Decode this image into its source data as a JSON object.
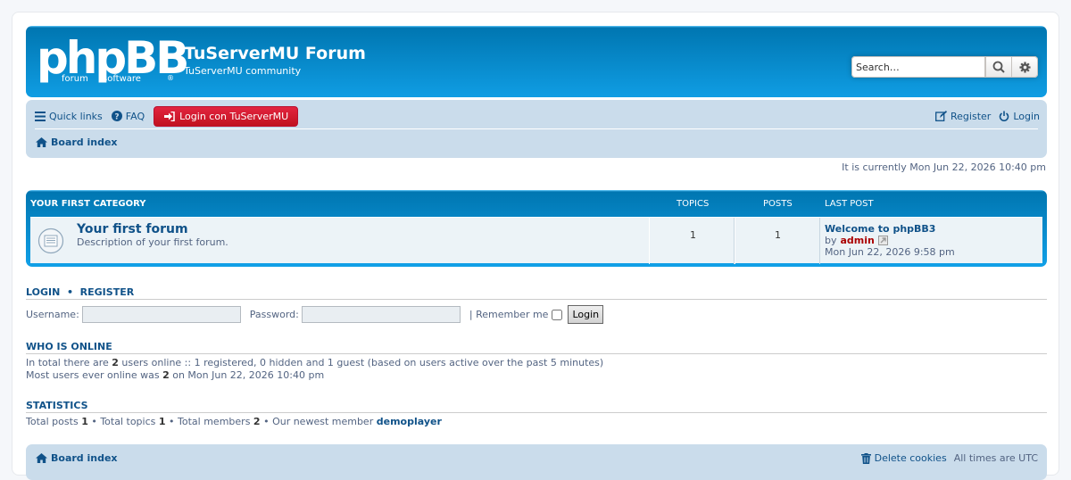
{
  "header": {
    "logo_main": "phpBB",
    "logo_sub_left": "forum",
    "logo_sub_right": "software",
    "logo_reg": "®",
    "site_title": "TuServerMU Forum",
    "site_description": "TuServerMU community",
    "search_placeholder": "Search…",
    "search_icon": "search-icon",
    "advanced_search_icon": "gear-icon"
  },
  "navbar": {
    "quick_links": "Quick links",
    "faq": "FAQ",
    "login_button": "Login con TuServerMU",
    "register": "Register",
    "login": "Login",
    "breadcrumb": "Board index"
  },
  "current_time": "It is currently Mon Jun 22, 2026 10:40 pm",
  "forum_table": {
    "category": "YOUR FIRST CATEGORY",
    "col_topics": "TOPICS",
    "col_posts": "POSTS",
    "col_last_post": "LAST POST",
    "rows": [
      {
        "title": "Your first forum",
        "description": "Description of your first forum.",
        "topics": "1",
        "posts": "1",
        "last_post_title": "Welcome to phpBB3",
        "last_post_by": "by",
        "last_post_author": "admin",
        "last_post_time": "Mon Jun 22, 2026 9:58 pm"
      }
    ]
  },
  "login_section": {
    "heading_login": "LOGIN",
    "heading_sep": "•",
    "heading_register": "REGISTER",
    "username_label": "Username:",
    "password_label": "Password:",
    "remember_label": "| Remember me",
    "login_button": "Login"
  },
  "who_is_online": {
    "heading": "WHO IS ONLINE",
    "line1_a": "In total there are",
    "line1_count": "2",
    "line1_b": "users online :: 1 registered, 0 hidden and 1 guest (based on users active over the past 5 minutes)",
    "line2_a": "Most users ever online was",
    "line2_count": "2",
    "line2_b": "on Mon Jun 22, 2026 10:40 pm"
  },
  "statistics": {
    "heading": "STATISTICS",
    "posts_label": "Total posts",
    "posts": "1",
    "topics_label": "• Total topics",
    "topics": "1",
    "members_label": "• Total members",
    "members": "2",
    "newest_label": "• Our newest member",
    "newest_member": "demoplayer"
  },
  "footer": {
    "breadcrumb": "Board index",
    "delete_cookies": "Delete cookies",
    "timezone": "All times are UTC"
  },
  "colors": {
    "header_blue": "#12a3eb",
    "navbar_bg": "#cadceb",
    "link_blue": "#105289",
    "login_red": "#d31141",
    "admin_red": "#aa0000"
  }
}
